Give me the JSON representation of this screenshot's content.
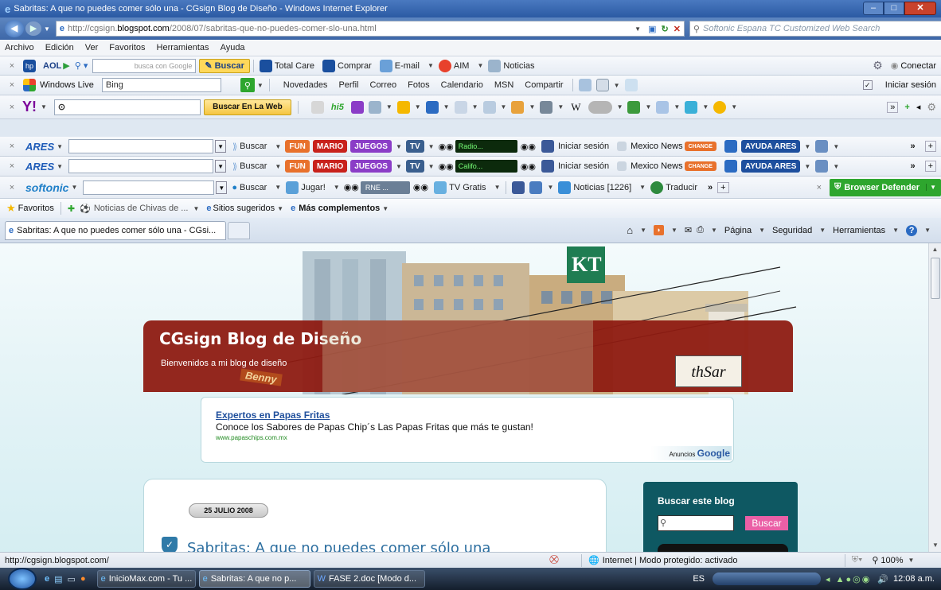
{
  "window": {
    "title": "Sabritas: A que no puedes comer sólo una - CGsign Blog de Diseño - Windows Internet Explorer",
    "min": "–",
    "max": "□",
    "close": "✕"
  },
  "address": {
    "url_prefix": "http://cgsign.",
    "url_domain": "blogspot.com",
    "url_path": "/2008/07/sabritas-que-no-puedes-comer-slo-una.html",
    "search_placeholder": "Softonic Espana TC Customized Web Search"
  },
  "menu": [
    "Archivo",
    "Edición",
    "Ver",
    "Favoritos",
    "Herramientas",
    "Ayuda"
  ],
  "aol": {
    "brand": "AOL",
    "search_hint": "busca con Google",
    "buscar": "Buscar",
    "items": [
      "Total Care",
      "Comprar",
      "E-mail",
      "AIM",
      "Noticias"
    ],
    "conectar": "Conectar"
  },
  "wl": {
    "brand": "Windows Live",
    "search_value": "Bing",
    "links": [
      "Novedades",
      "Perfil",
      "Correo",
      "Fotos",
      "Calendario",
      "MSN",
      "Compartir"
    ],
    "signin": "Iniciar sesión"
  },
  "yahoo": {
    "button": "Buscar En La Web"
  },
  "ares1": {
    "brand": "ARES",
    "buscar": "Buscar",
    "fun": "FUN",
    "mario": "MARIO",
    "juegos": "JUEGOS",
    "tv": "TV",
    "radio": "Radio...",
    "signin": "Iniciar sesión",
    "news": "Mexico News",
    "change": "CHANGE",
    "ayuda": "AYUDA ARES"
  },
  "ares2": {
    "brand": "ARES",
    "buscar": "Buscar",
    "fun": "FUN",
    "mario": "MARIO",
    "juegos": "JUEGOS",
    "tv": "TV",
    "radio": "Califo...",
    "signin": "Iniciar sesión",
    "news": "Mexico News",
    "change": "CHANGE",
    "ayuda": "AYUDA ARES"
  },
  "softonic": {
    "brand": "softonic",
    "buscar": "Buscar",
    "jugar": "Jugar!",
    "rne": "RNE ...",
    "tvgratis": "TV Gratis",
    "noticias": "Noticias [1226]",
    "traducir": "Traducir",
    "defender": "Browser Defender"
  },
  "favbar": {
    "favoritos": "Favoritos",
    "chivas": "Noticias de Chivas de ...",
    "sugeridos": "Sitios sugeridos",
    "complementos": "Más complementos"
  },
  "tab": {
    "label": "Sabritas: A que no puedes comer sólo una - CGsi...",
    "pagina": "Página",
    "seguridad": "Seguridad",
    "herramientas": "Herramientas"
  },
  "blog": {
    "title": "CGsign Blog de Diseño",
    "subtitle": "Bienvenidos a mi blog de diseño",
    "sign_kt": "KT",
    "sign_benny": "Benny",
    "signature": "thSar"
  },
  "ad": {
    "title": "Expertos en Papas Fritas",
    "text": "Conoce los Sabores de Papas Chip´s Las Papas Fritas que más te gustan!",
    "url": "www.papaschips.com.mx",
    "by": "Anuncios",
    "google": "Google"
  },
  "post": {
    "date": "25 JULIO 2008",
    "title": "Sabritas: A que no puedes comer sólo una"
  },
  "sidebar": {
    "heading": "Buscar este blog",
    "button": "Buscar"
  },
  "status": {
    "url": "http://cgsign.blogspot.com/",
    "zone": "Internet | Modo protegido: activado",
    "zoom": "100%"
  },
  "taskbar": {
    "items": [
      "InicioMax.com - Tu ...",
      "Sabritas: A que no p...",
      "FASE 2.doc [Modo d..."
    ],
    "lang": "ES",
    "clock": "12:08 a.m."
  },
  "colors": {
    "title_bar": "#2b5aa3",
    "header_red": "#8e1b12",
    "page_bg": "#cfe9ee",
    "sidebar": "#0e5862",
    "defender": "#2ea62e"
  }
}
